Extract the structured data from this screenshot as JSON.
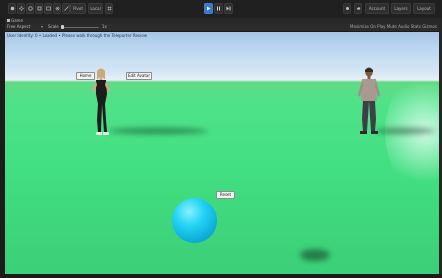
{
  "toolbar": {
    "left_controls": [
      "Pivot",
      "Local"
    ],
    "account_label": "Account",
    "layers_label": "Layers",
    "layout_label": "Layout"
  },
  "game_view": {
    "tab_label": "Game",
    "display_label": "Free Aspect",
    "scale_label": "Scale",
    "scale_value": "1x",
    "right_options": "Maximize On Play   Mute Audio   Stats   Gizmos"
  },
  "scene": {
    "status_text": "User Identity: 0 • Loaded • Please walk through the Teleporter Review",
    "home_button": "Home",
    "edit_avatar_button": "Edit Avatar",
    "reset_button": "Reset"
  },
  "colors": {
    "ground": "#43e082",
    "sky": "#bcd7f1",
    "sphere": "#24d3f3",
    "play_accent": "#3a78c2"
  }
}
